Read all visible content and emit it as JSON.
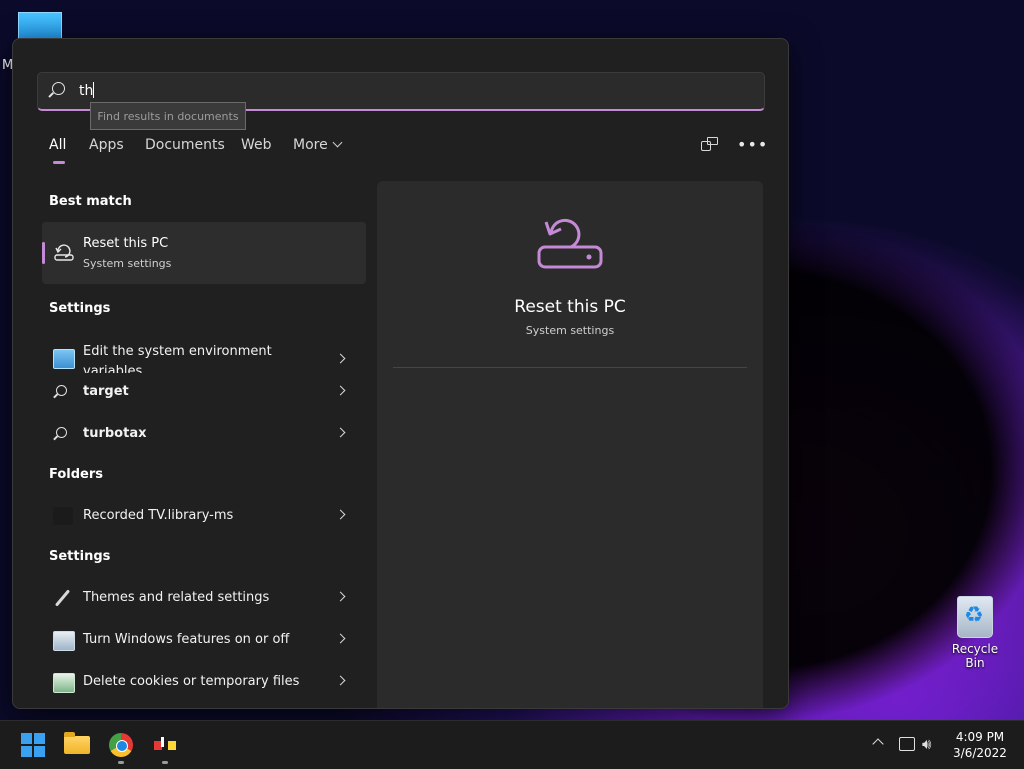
{
  "desktop": {
    "partial_label": "M",
    "recycle_bin_label": "Recycle Bin"
  },
  "search": {
    "query": "th",
    "tooltip": "Find results in documents"
  },
  "tabs": [
    {
      "label": "All",
      "active": true
    },
    {
      "label": "Apps"
    },
    {
      "label": "Documents"
    },
    {
      "label": "Web"
    },
    {
      "label": "More"
    }
  ],
  "sections": {
    "best_match": "Best match",
    "settings": "Settings",
    "folders": "Folders",
    "settings2": "Settings"
  },
  "best_match": {
    "title": "Reset this PC",
    "subtitle": "System settings"
  },
  "settings_items": [
    {
      "label": "Edit the system environment variables",
      "icon": "environment-icon"
    },
    {
      "label": "target",
      "icon": "search-icon"
    },
    {
      "label": "turbotax",
      "icon": "search-icon"
    }
  ],
  "folder_items": [
    {
      "label": "Recorded TV.library-ms",
      "icon": "folder-icon"
    }
  ],
  "settings2_items": [
    {
      "label": "Themes and related settings",
      "icon": "brush-icon"
    },
    {
      "label": "Turn Windows features on or off",
      "icon": "windows-features-icon"
    },
    {
      "label": "Delete cookies or temporary files",
      "icon": "internet-options-icon"
    }
  ],
  "preview": {
    "title": "Reset this PC",
    "subtitle": "System settings"
  },
  "taskbar": {
    "time": "4:09 PM",
    "date": "3/6/2022"
  },
  "colors": {
    "accent": "#c58ad6",
    "panel_bg": "#202020",
    "preview_bg": "#2b2b2b",
    "taskbar_bg": "#1c1c1c"
  }
}
